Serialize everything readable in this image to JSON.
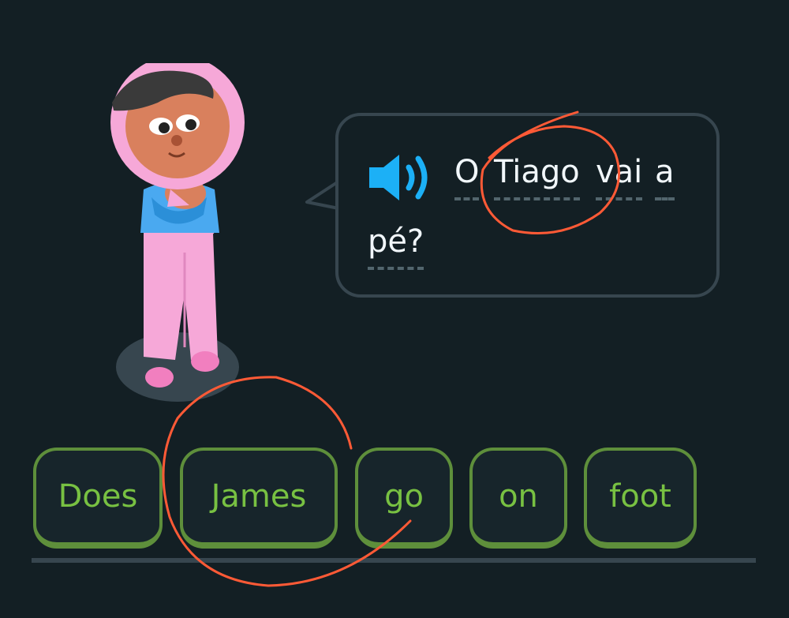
{
  "prompt": {
    "audio_icon": "speaker-volume-icon",
    "words": [
      "O",
      "Tiago",
      "vai",
      "a",
      "pé?"
    ]
  },
  "word_bank": {
    "chips": [
      "Does",
      "James",
      "go",
      "on",
      "foot"
    ]
  },
  "colors": {
    "background": "#131f24",
    "bubble_border": "#37464f",
    "chip_border": "#5e8f3b",
    "chip_text": "#78c142",
    "speaker": "#1cb0f6",
    "annotation": "#ff5a36"
  }
}
